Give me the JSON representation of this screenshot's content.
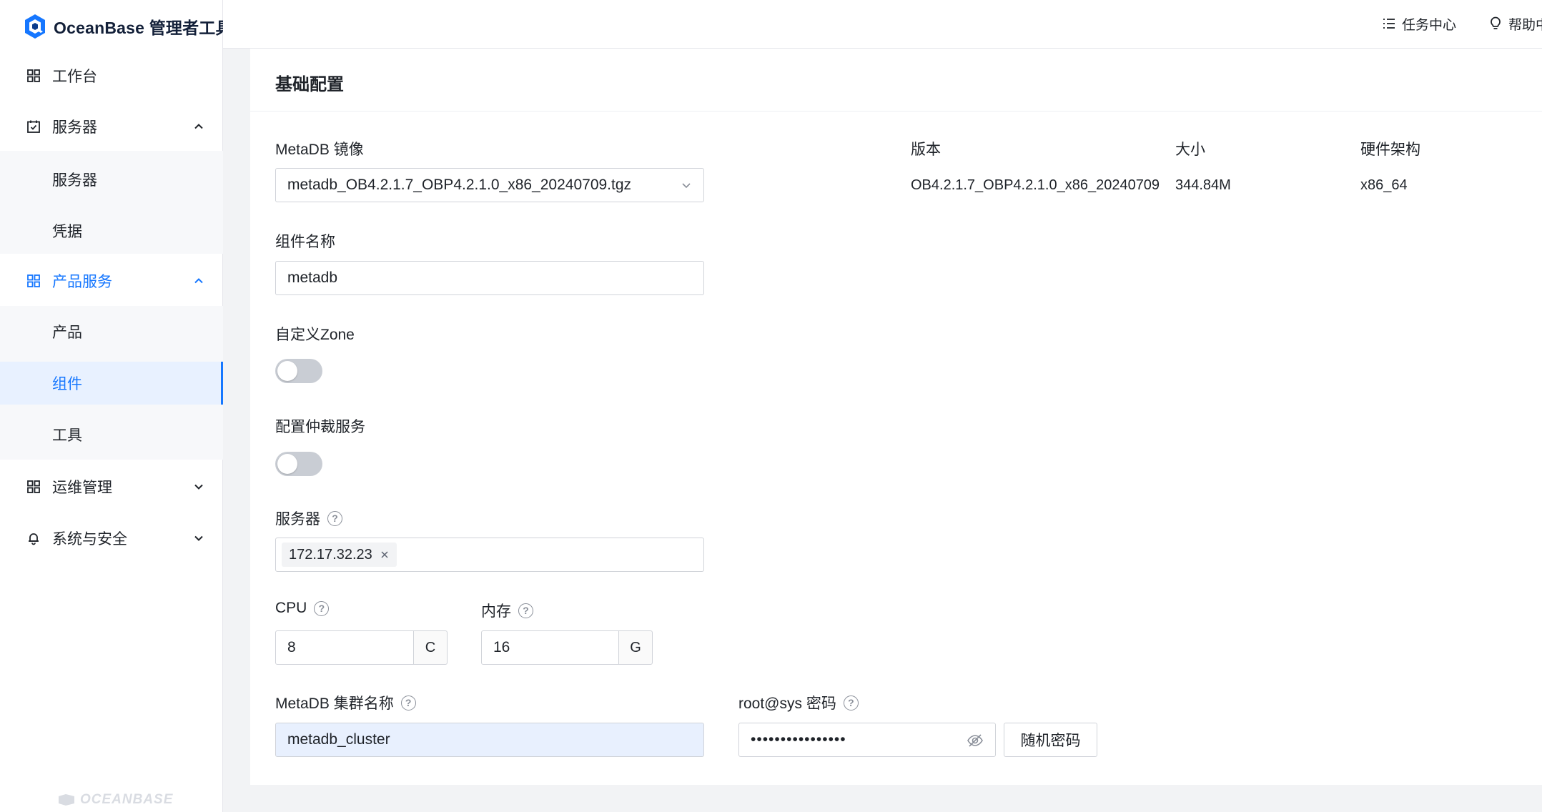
{
  "brand": {
    "name": "OceanBase 管理者工具",
    "watermark": "OCEANBASE",
    "accent": "#1677ff"
  },
  "sidebar": {
    "items": [
      {
        "label": "工作台",
        "icon": "grid-icon"
      },
      {
        "label": "服务器",
        "icon": "calendar-check-icon",
        "expanded": true,
        "children": [
          {
            "label": "服务器"
          },
          {
            "label": "凭据"
          }
        ]
      },
      {
        "label": "产品服务",
        "icon": "grid-icon",
        "expanded": true,
        "active": true,
        "children": [
          {
            "label": "产品"
          },
          {
            "label": "组件",
            "selected": true
          },
          {
            "label": "工具"
          }
        ]
      },
      {
        "label": "运维管理",
        "icon": "grid-icon",
        "expanded": false
      },
      {
        "label": "系统与安全",
        "icon": "bell-icon",
        "expanded": false
      }
    ]
  },
  "topbar": {
    "task_center": "任务中心",
    "help_center": "帮助中"
  },
  "form": {
    "section_title": "基础配置",
    "metadb_image": {
      "label": "MetaDB 镜像",
      "value": "metadb_OB4.2.1.7_OBP4.2.1.0_x86_20240709.tgz"
    },
    "image_info": {
      "headers": {
        "version": "版本",
        "size": "大小",
        "arch": "硬件架构"
      },
      "values": {
        "version": "OB4.2.1.7_OBP4.2.1.0_x86_20240709",
        "size": "344.84M",
        "arch": "x86_64"
      }
    },
    "component_name": {
      "label": "组件名称",
      "value": "metadb"
    },
    "custom_zone": {
      "label": "自定义Zone",
      "on": false
    },
    "arbitration": {
      "label": "配置仲裁服务",
      "on": false
    },
    "servers": {
      "label": "服务器",
      "tags": [
        "172.17.32.23"
      ]
    },
    "cpu": {
      "label": "CPU",
      "value": "8",
      "unit": "C"
    },
    "memory": {
      "label": "内存",
      "value": "16",
      "unit": "G"
    },
    "cluster_name": {
      "label": "MetaDB 集群名称",
      "value": "metadb_cluster"
    },
    "root_password": {
      "label": "root@sys 密码",
      "value": "••••••••••••••••",
      "random_button": "随机密码"
    }
  }
}
